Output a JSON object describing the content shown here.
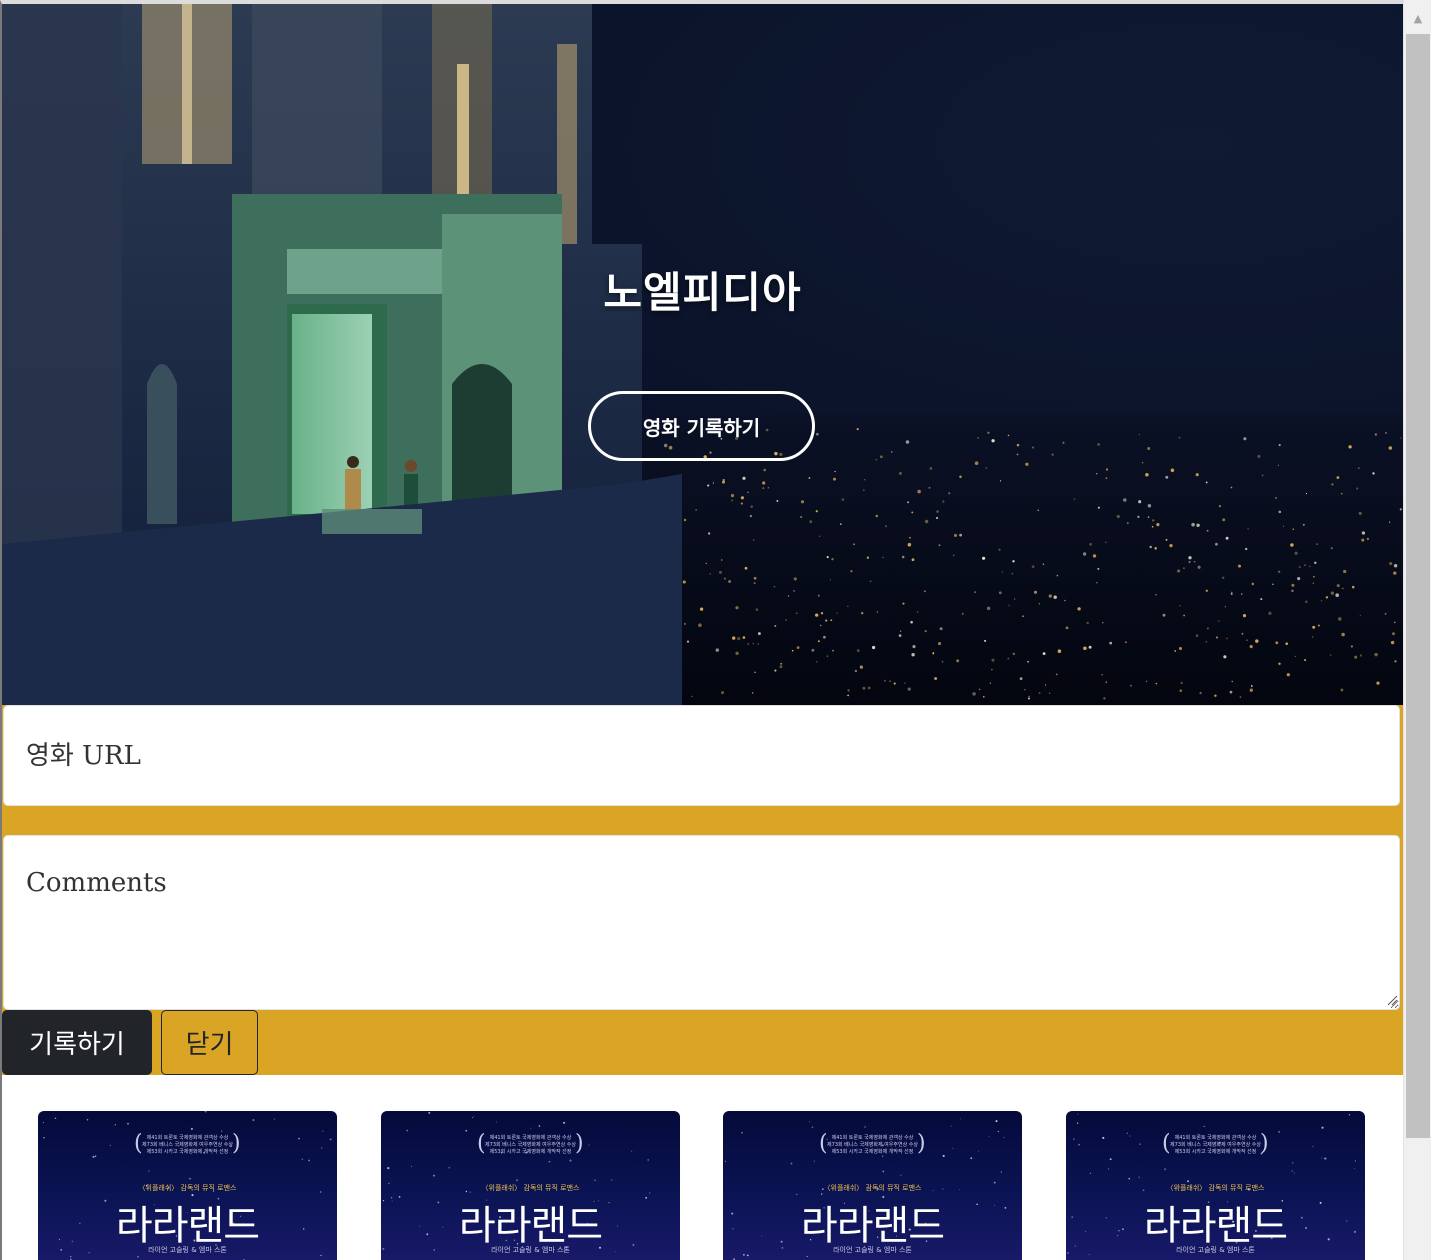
{
  "hero": {
    "title": "노엘피디아",
    "record_button": "영화 기록하기"
  },
  "form": {
    "url_placeholder": "영화 URL",
    "comments_placeholder": "Comments",
    "save_button": "기록하기",
    "close_button": "닫기"
  },
  "cards": [
    {
      "awards": "제41회 토론토 국제영화제 관객상 수상\n제73회 베니스 국제영화제 여우주연상 수상\n제53회 시카고 국제영화제 개막작 선정",
      "tagline": "〈위플래쉬〉 감독의 뮤직 로맨스",
      "title": "라라랜드",
      "cast": "라이언 고슬링 & 엠마 스톤"
    },
    {
      "awards": "제41회 토론토 국제영화제 관객상 수상\n제73회 베니스 국제영화제 여우주연상 수상\n제53회 시카고 국제영화제 개막작 선정",
      "tagline": "〈위플래쉬〉 감독의 뮤직 로맨스",
      "title": "라라랜드",
      "cast": "라이언 고슬링 & 엠마 스톤"
    },
    {
      "awards": "제41회 토론토 국제영화제 관객상 수상\n제73회 베니스 국제영화제 여우주연상 수상\n제53회 시카고 국제영화제 개막작 선정",
      "tagline": "〈위플래쉬〉 감독의 뮤직 로맨스",
      "title": "라라랜드",
      "cast": "라이언 고슬링 & 엠마 스톤"
    },
    {
      "awards": "제41회 토론토 국제영화제 관객상 수상\n제73회 베니스 국제영화제 여우주연상 수상\n제53회 시카고 국제영화제 개막작 선정",
      "tagline": "〈위플래쉬〉 감독의 뮤직 로맨스",
      "title": "라라랜드",
      "cast": "라이언 고슬링 & 엠마 스톤"
    }
  ],
  "colors": {
    "form_background": "#daa425",
    "primary_button": "#212529",
    "hero_sky": "#0a1228",
    "poster_background": "#0b1455"
  },
  "icons": {
    "scroll_up": "triangle-up-icon",
    "resize": "resize-grip-icon"
  }
}
